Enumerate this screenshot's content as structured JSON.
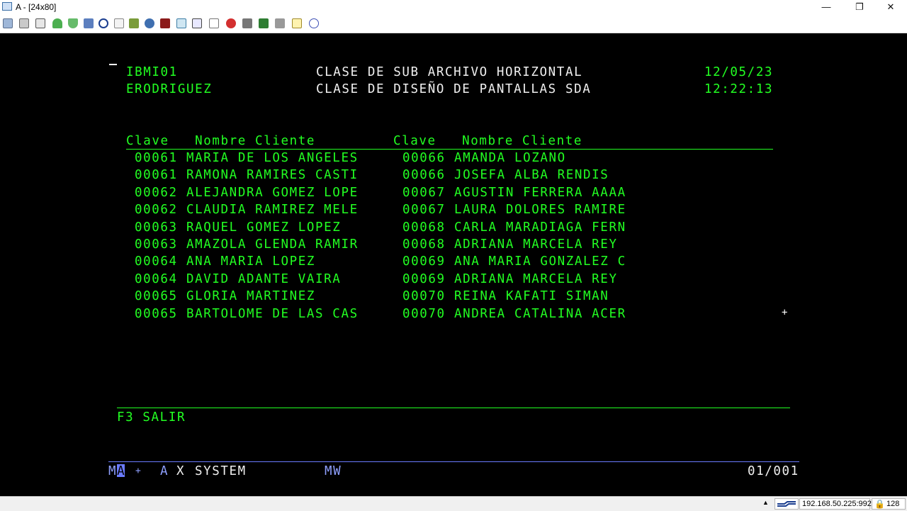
{
  "window": {
    "title": "A - [24x80]",
    "controls": [
      "—",
      "❐",
      "✕"
    ]
  },
  "toolbar": {
    "icons": [
      "copy-icon",
      "paste-icon",
      "print-icon",
      "send-file-icon",
      "receive-file-icon",
      "disk-icon",
      "navigate-icon",
      "notes-icon",
      "package-icon",
      "macro-icon",
      "record-icon",
      "screen-icon",
      "keyboard-icon",
      "tools-icon",
      "run-icon",
      "stop-icon",
      "play-icon",
      "trash-icon",
      "document-icon",
      "help-icon"
    ]
  },
  "header": {
    "program": "IBMI01",
    "user": "ERODRIGUEZ",
    "title_line1": "CLASE DE SUB ARCHIVO HORIZONTAL",
    "title_line2": "CLASE DE DISEÑO DE PANTALLAS SDA",
    "date": "12/05/23",
    "time": "12:22:13"
  },
  "columns": {
    "left": "Clave   Nombre Cliente",
    "right": "Clave   Nombre Cliente"
  },
  "rows": [
    {
      "k1": "00061",
      "n1": "MARIA DE LOS ANGELES",
      "k2": "00066",
      "n2": "AMANDA LOZANO"
    },
    {
      "k1": "00061",
      "n1": "RAMONA RAMIRES CASTI",
      "k2": "00066",
      "n2": "JOSEFA ALBA RENDIS"
    },
    {
      "k1": "00062",
      "n1": "ALEJANDRA GOMEZ LOPE",
      "k2": "00067",
      "n2": "AGUSTIN FERRERA AAAA"
    },
    {
      "k1": "00062",
      "n1": "CLAUDIA RAMIREZ MELE",
      "k2": "00067",
      "n2": "LAURA DOLORES RAMIRE"
    },
    {
      "k1": "00063",
      "n1": "RAQUEL GOMEZ LOPEZ",
      "k2": "00068",
      "n2": "CARLA MARADIAGA FERN"
    },
    {
      "k1": "00063",
      "n1": "AMAZOLA GLENDA RAMIR",
      "k2": "00068",
      "n2": "ADRIANA MARCELA REY"
    },
    {
      "k1": "00064",
      "n1": "ANA MARIA LOPEZ",
      "k2": "00069",
      "n2": "ANA MARIA GONZALEZ C"
    },
    {
      "k1": "00064",
      "n1": "DAVID ADANTE VAIRA",
      "k2": "00069",
      "n2": "ADRIANA MARCELA REY"
    },
    {
      "k1": "00065",
      "n1": "GLORIA MARTINEZ",
      "k2": "00070",
      "n2": "REINA KAFATI SIMAN"
    },
    {
      "k1": "00065",
      "n1": "BARTOLOME DE LAS CAS",
      "k2": "00070",
      "n2": "ANDREA CATALINA ACER"
    }
  ],
  "more_indicator": "+",
  "function_keys": "F3 SALIR",
  "oia": {
    "ma_prefix": "M",
    "ma_cursor": "A",
    "ma_plus": "+",
    "session": "A",
    "x_mark": "X",
    "system": "SYSTEM",
    "mw": "MW",
    "position": "01/001"
  },
  "statusbar": {
    "host": "192.168.50.225:992",
    "encryption": "128"
  },
  "colors": {
    "terminal_green": "#22ff22",
    "terminal_white": "#f0f0f0",
    "oia_blue": "#8fa0ff"
  }
}
